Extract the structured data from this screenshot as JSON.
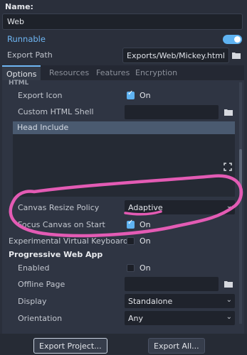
{
  "name_label": "Name:",
  "name_value": "Web",
  "runnable_label": "Runnable",
  "export_path_label": "Export Path",
  "export_path_value": "Exports/Web/Mickey.html",
  "tabs": [
    "Options",
    "Resources",
    "Features",
    "Encryption"
  ],
  "section_partial": "HTML",
  "rows": {
    "export_icon": {
      "label": "Export Icon",
      "value": "On"
    },
    "custom_html_shell": {
      "label": "Custom HTML Shell"
    },
    "head_include": {
      "label": "Head Include"
    },
    "canvas_resize_policy": {
      "label": "Canvas Resize Policy",
      "value": "Adaptive"
    },
    "focus_canvas": {
      "label": "Focus Canvas on Start",
      "value": "On"
    },
    "experimental_vk": {
      "label": "Experimental Virtual Keyboard",
      "value": "On"
    }
  },
  "pwa": {
    "title": "Progressive Web App",
    "enabled": {
      "label": "Enabled",
      "value": "On"
    },
    "offline_page": {
      "label": "Offline Page"
    },
    "display": {
      "label": "Display",
      "value": "Standalone"
    },
    "orientation": {
      "label": "Orientation",
      "value": "Any"
    }
  },
  "buttons": {
    "export_project": "Export Project...",
    "export_all": "Export All..."
  },
  "colors": {
    "accent": "#5fb3f2",
    "annotation": "#e35bb4"
  },
  "icons": [
    "folder-icon",
    "expand-icon",
    "chevron-down-icon",
    "checkbox-icon"
  ]
}
